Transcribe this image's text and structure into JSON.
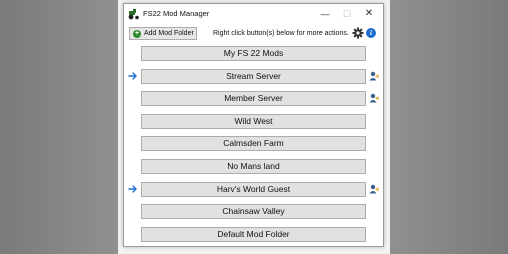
{
  "window": {
    "title": "FS22 Mod Manager",
    "minimize_label": "—",
    "maximize_label": "☐",
    "close_label": "✕"
  },
  "toolbar": {
    "add_folder_label": "Add Mod Folder",
    "hint_text": "Right click button(s) below for more actions.",
    "settings_icon": "gear-icon",
    "info_icon": "info-icon",
    "info_glyph": "i"
  },
  "mods": [
    {
      "label": "My FS 22 Mods",
      "active": false,
      "shared": false
    },
    {
      "label": "Stream Server",
      "active": true,
      "shared": true
    },
    {
      "label": "Member Server",
      "active": false,
      "shared": true
    },
    {
      "label": "Wild West",
      "active": false,
      "shared": false
    },
    {
      "label": "Calmsden Farm",
      "active": false,
      "shared": false
    },
    {
      "label": "No Mans land",
      "active": false,
      "shared": false
    },
    {
      "label": "Harv's World Guest",
      "active": true,
      "shared": true
    },
    {
      "label": "Chainsaw Valley",
      "active": false,
      "shared": false
    },
    {
      "label": "Default Mod Folder",
      "active": false,
      "shared": false
    }
  ],
  "colors": {
    "active_arrow": "#1f6fd1",
    "add_icon": "#2e8b2e",
    "info_icon": "#1f6fd1"
  }
}
